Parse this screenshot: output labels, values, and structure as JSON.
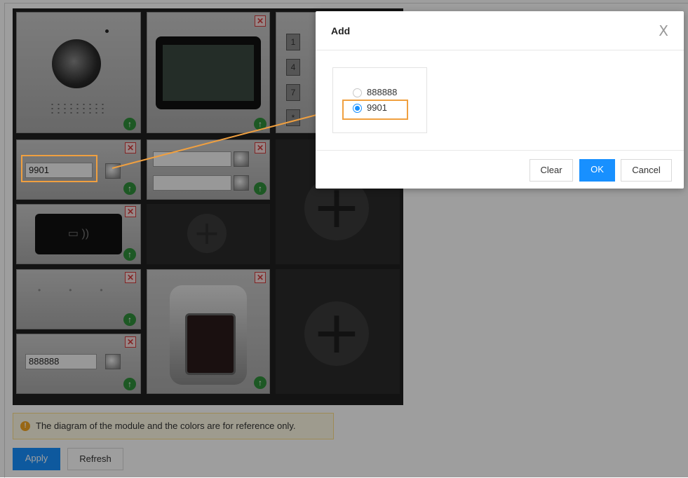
{
  "modules": {
    "row2_left_input": "9901",
    "row4_left_input": "888888"
  },
  "notice": {
    "text": "The diagram of the module and the colors are for reference only."
  },
  "actions": {
    "apply_label": "Apply",
    "refresh_label": "Refresh"
  },
  "dialog": {
    "title": "Add",
    "close_glyph": "X",
    "options": [
      {
        "label": "888888",
        "selected": false
      },
      {
        "label": "9901",
        "selected": true
      }
    ],
    "clear_label": "Clear",
    "ok_label": "OK",
    "cancel_label": "Cancel"
  },
  "colors": {
    "accent": "#1890ff",
    "highlight": "#f0a040",
    "delete": "#d23c3c",
    "up": "#2f8f3a"
  }
}
